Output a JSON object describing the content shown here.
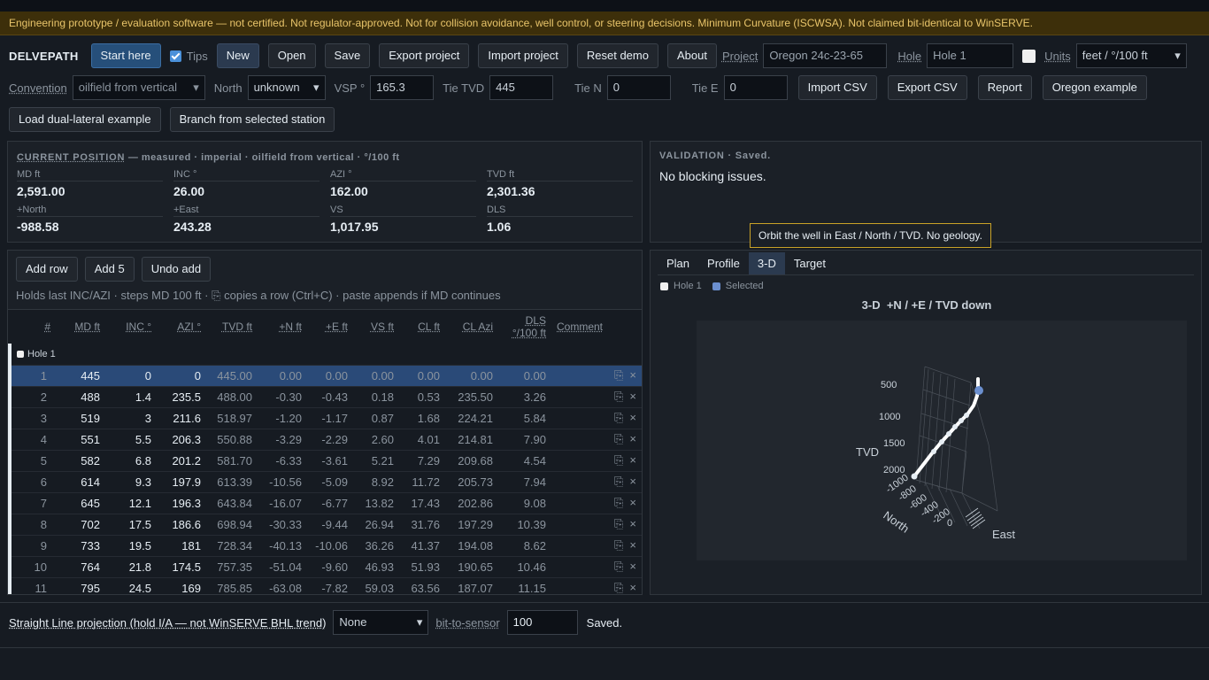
{
  "banner": "Engineering prototype / evaluation software — not certified. Not regulator-approved. Not for collision avoidance, well control, or steering decisions. Minimum Curvature (ISCWSA). Not claimed bit-identical to WinSERVE.",
  "app": {
    "name": "DELVEPATH"
  },
  "toolbar": {
    "start_here": "Start here",
    "tips_label": "Tips",
    "new": "New",
    "open": "Open",
    "save": "Save",
    "export_project": "Export project",
    "import_project": "Import project",
    "reset_demo": "Reset demo",
    "about": "About",
    "project_label": "Project",
    "project_value": "Oregon 24c-23-65",
    "hole_label": "Hole",
    "hole_value": "Hole 1",
    "units_label": "Units",
    "units_value": "feet / °/100 ft",
    "convention_label": "Convention",
    "convention_value": "oilfield from vertical",
    "north_label": "North",
    "north_value": "unknown",
    "vsp_label": "VSP °",
    "vsp_value": "165.3",
    "tie_tvd_label": "Tie TVD",
    "tie_tvd_value": "445",
    "tie_n_label": "Tie N",
    "tie_n_value": "0",
    "tie_e_label": "Tie E",
    "tie_e_value": "0",
    "import_csv": "Import CSV",
    "export_csv": "Export CSV",
    "report": "Report",
    "oregon_example": "Oregon example",
    "load_dual": "Load dual-lateral example",
    "branch": "Branch from selected station"
  },
  "position": {
    "title": "CURRENT POSITION",
    "subtitle": "— measured · imperial · oilfield from vertical · °/100 ft",
    "metrics": [
      {
        "k": "MD ft",
        "v": "2,591.00"
      },
      {
        "k": "INC °",
        "v": "26.00"
      },
      {
        "k": "AZI °",
        "v": "162.00"
      },
      {
        "k": "TVD ft",
        "v": "2,301.36"
      },
      {
        "k": "+North",
        "v": "-988.58"
      },
      {
        "k": "+East",
        "v": "243.28"
      },
      {
        "k": "VS",
        "v": "1,017.95"
      },
      {
        "k": "DLS",
        "v": "1.06"
      }
    ]
  },
  "validation": {
    "title": "VALIDATION · Saved.",
    "message": "No blocking issues."
  },
  "tooltip": "Orbit the well in East / North / TVD. No geology.",
  "survey": {
    "add_row": "Add row",
    "add5": "Add 5",
    "undo": "Undo add",
    "hint": "Holds last INC/AZI · steps MD 100 ft ·",
    "hint2": "copies a row (Ctrl+C) · paste appends if MD continues",
    "columns": [
      "#",
      "MD ft",
      "INC °",
      "AZI °",
      "TVD ft",
      "+N ft",
      "+E ft",
      "VS ft",
      "CL ft",
      "CL Azi",
      "DLS °/100 ft",
      "Comment"
    ],
    "group": "Hole 1",
    "rows": [
      [
        "1",
        "445",
        "0",
        "0",
        "445.00",
        "0.00",
        "0.00",
        "0.00",
        "0.00",
        "0.00",
        "0.00"
      ],
      [
        "2",
        "488",
        "1.4",
        "235.5",
        "488.00",
        "-0.30",
        "-0.43",
        "0.18",
        "0.53",
        "235.50",
        "3.26"
      ],
      [
        "3",
        "519",
        "3",
        "211.6",
        "518.97",
        "-1.20",
        "-1.17",
        "0.87",
        "1.68",
        "224.21",
        "5.84"
      ],
      [
        "4",
        "551",
        "5.5",
        "206.3",
        "550.88",
        "-3.29",
        "-2.29",
        "2.60",
        "4.01",
        "214.81",
        "7.90"
      ],
      [
        "5",
        "582",
        "6.8",
        "201.2",
        "581.70",
        "-6.33",
        "-3.61",
        "5.21",
        "7.29",
        "209.68",
        "4.54"
      ],
      [
        "6",
        "614",
        "9.3",
        "197.9",
        "613.39",
        "-10.56",
        "-5.09",
        "8.92",
        "11.72",
        "205.73",
        "7.94"
      ],
      [
        "7",
        "645",
        "12.1",
        "196.3",
        "643.84",
        "-16.07",
        "-6.77",
        "13.82",
        "17.43",
        "202.86",
        "9.08"
      ],
      [
        "8",
        "702",
        "17.5",
        "186.6",
        "698.94",
        "-30.33",
        "-9.44",
        "26.94",
        "31.76",
        "197.29",
        "10.39"
      ],
      [
        "9",
        "733",
        "19.5",
        "181",
        "728.34",
        "-40.13",
        "-10.06",
        "36.26",
        "41.37",
        "194.08",
        "8.62"
      ],
      [
        "10",
        "764",
        "21.8",
        "174.5",
        "757.35",
        "-51.04",
        "-9.60",
        "46.93",
        "51.93",
        "190.65",
        "10.46"
      ],
      [
        "11",
        "795",
        "24.5",
        "169",
        "785.85",
        "-63.08",
        "-7.82",
        "59.03",
        "63.56",
        "187.07",
        "11.15"
      ]
    ]
  },
  "viewer": {
    "tabs": [
      "Plan",
      "Profile",
      "3-D",
      "Target"
    ],
    "legend_hole": "Hole 1",
    "legend_selected": "Selected",
    "title": "3-D  +N / +E / TVD down",
    "axis_tvd": "TVD",
    "axis_north": "North",
    "axis_east": "East",
    "tvd_ticks": [
      "500",
      "1000",
      "1500",
      "2000"
    ],
    "north_ticks": [
      "-1000",
      "-800",
      "-600",
      "-400",
      "-200",
      "0"
    ],
    "colors": {
      "hole": "#ffffff",
      "selected": "#6b8fcf"
    }
  },
  "footer": {
    "projection_label": "Straight Line projection (hold I/A — not WinSERVE BHL trend)",
    "projection_value": "None",
    "bit_label": "bit-to-sensor",
    "bit_value": "100",
    "status": "Saved."
  }
}
